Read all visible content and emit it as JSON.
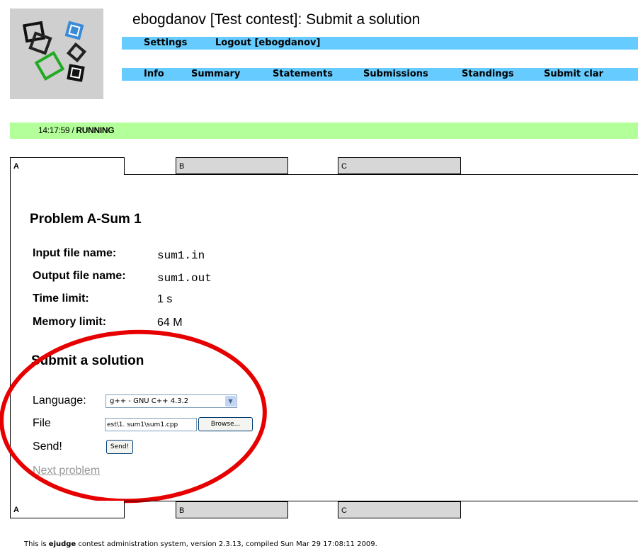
{
  "page": {
    "title": "ebogdanov [Test contest]: Submit a solution"
  },
  "top_menu": [
    {
      "label": "Settings"
    },
    {
      "label": "Logout [ebogdanov]"
    }
  ],
  "main_menu": [
    {
      "label": "Info"
    },
    {
      "label": "Summary"
    },
    {
      "label": "Statements"
    },
    {
      "label": "Submissions"
    },
    {
      "label": "Standings"
    },
    {
      "label": "Submit clar"
    }
  ],
  "status": {
    "time": "14:17:59",
    "separator": " / ",
    "state": "RUNNING"
  },
  "tabs": [
    "A",
    "B",
    "C"
  ],
  "problem": {
    "heading": "Problem A-Sum 1",
    "props": [
      {
        "label": "Input file name:",
        "value": "sum1.in"
      },
      {
        "label": "Output file name:",
        "value": "sum1.out"
      },
      {
        "label": "Time limit:",
        "value": "1 s"
      },
      {
        "label": "Memory limit:",
        "value": "64 M"
      }
    ]
  },
  "submit": {
    "heading": "Submit a solution",
    "language_label": "Language:",
    "language_value": "g++ - GNU C++ 4.3.2",
    "file_label": "File",
    "file_value": "est\\1. sum1\\sum1.cpp",
    "browse_label": "Browse...",
    "send_label": "Send!",
    "send_button": "Send!",
    "next_problem": "Next problem"
  },
  "footer": {
    "prefix": "This is ",
    "link": "ejudge",
    "suffix": " contest administration system, version 2.3.13, compiled Sun Mar 29 17:08:11 2009."
  },
  "colors": {
    "menu_bar": "#66ccff",
    "status_bar": "#b3ff99",
    "annotation_oval": "#e60000"
  }
}
